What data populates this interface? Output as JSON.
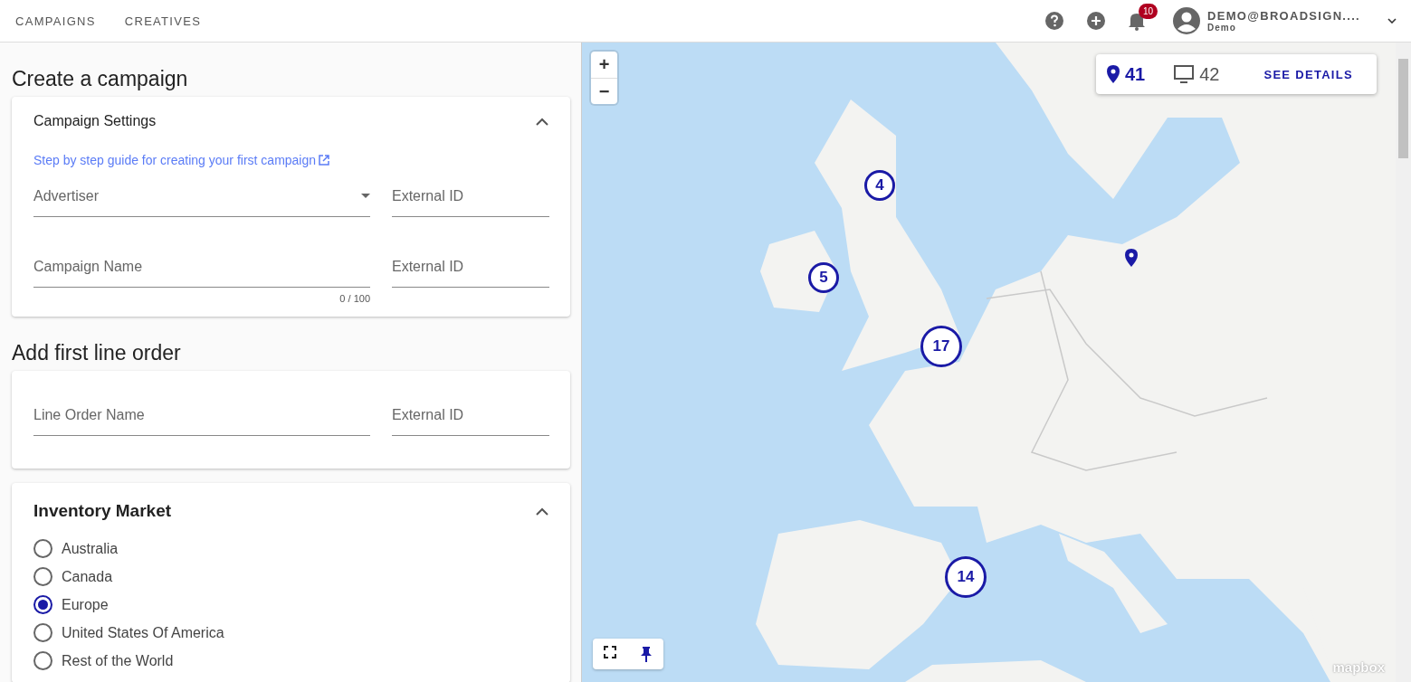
{
  "nav": {
    "items": [
      {
        "label": "CAMPAIGNS"
      },
      {
        "label": "CREATIVES"
      }
    ],
    "notifications": "10",
    "user": {
      "email": "DEMO@BROADSIGN....",
      "org": "Demo"
    }
  },
  "page_title": "Create a campaign",
  "campaign_settings": {
    "title": "Campaign Settings",
    "expanded": true,
    "guide_link": "Step by step guide for creating your first campaign",
    "fields": [
      {
        "kind": "select",
        "placeholder": "Advertiser"
      },
      {
        "kind": "text",
        "placeholder": "External ID"
      },
      {
        "kind": "text",
        "placeholder": "Campaign Name",
        "counter": "0 / 100"
      },
      {
        "kind": "text",
        "placeholder": "External ID"
      }
    ]
  },
  "line_order_title": "Add first line order",
  "line_order": {
    "fields": [
      {
        "kind": "text",
        "placeholder": "Line Order Name"
      },
      {
        "kind": "text",
        "placeholder": "External ID"
      }
    ]
  },
  "inventory_market": {
    "title": "Inventory Market",
    "expanded": true,
    "options": [
      {
        "label": "Australia",
        "selected": false
      },
      {
        "label": "Canada",
        "selected": false
      },
      {
        "label": "Europe",
        "selected": true
      },
      {
        "label": "United States Of America",
        "selected": false
      },
      {
        "label": "Rest of the World",
        "selected": false
      }
    ]
  },
  "map": {
    "summary": {
      "locations": "41",
      "screens": "42",
      "action": "SEE DETAILS"
    },
    "zoom_in": "+",
    "zoom_out": "−",
    "clusters": [
      {
        "count": "4"
      },
      {
        "count": "5"
      },
      {
        "count": "17"
      },
      {
        "count": "14"
      }
    ],
    "attribution": "mapbox"
  }
}
